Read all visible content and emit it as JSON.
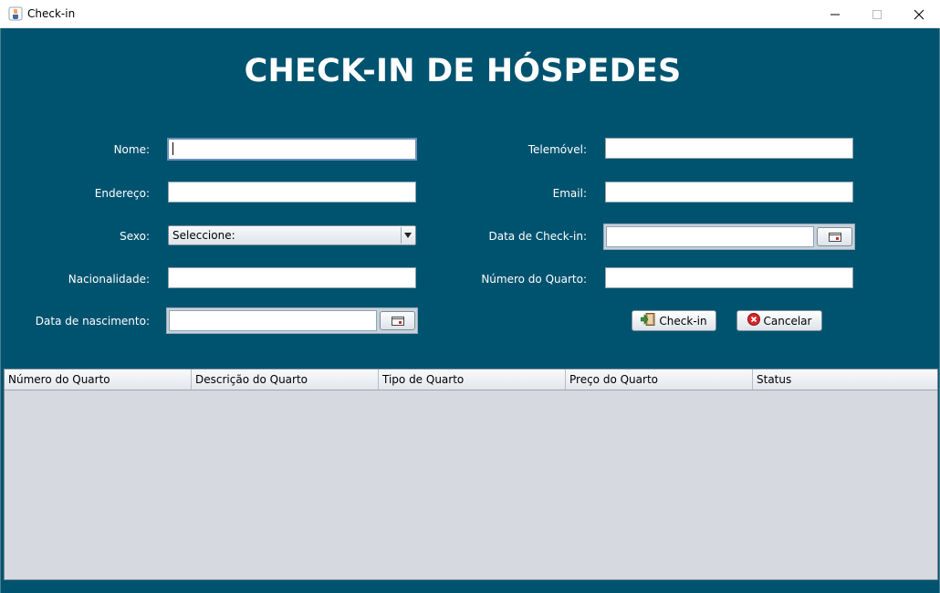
{
  "window": {
    "title": "Check-in",
    "app_icon": "java-cup-icon",
    "controls": [
      "minimize-icon",
      "maximize-icon",
      "close-icon"
    ]
  },
  "heading": "CHECK-IN DE HÓSPEDES",
  "form": {
    "nome_label": "Nome:",
    "endereco_label": "Endereço:",
    "sexo_label": "Sexo:",
    "sexo_value": "Seleccione:",
    "nacionalidade_label": "Nacionalidade:",
    "data_nascimento_label": "Data de nascimento:",
    "telemovel_label": "Telemóvel:",
    "email_label": "Email:",
    "data_checkin_label": "Data de Check-in:",
    "numero_quarto_label": "Número do Quarto:"
  },
  "buttons": {
    "checkin_label": "Check-in",
    "checkin_icon": "door-enter-icon",
    "cancelar_label": "Cancelar",
    "cancelar_icon": "cancel-icon"
  },
  "table": {
    "columns": [
      "Número do Quarto",
      "Descrição do Quarto",
      "Tipo de Quarto",
      "Preço do Quarto",
      "Status"
    ],
    "rows": []
  },
  "colors": {
    "background": "#00536f",
    "table_background": "#d6d9e0",
    "cancel_red": "#d9262b",
    "checkin_green": "#3e8a3a"
  }
}
